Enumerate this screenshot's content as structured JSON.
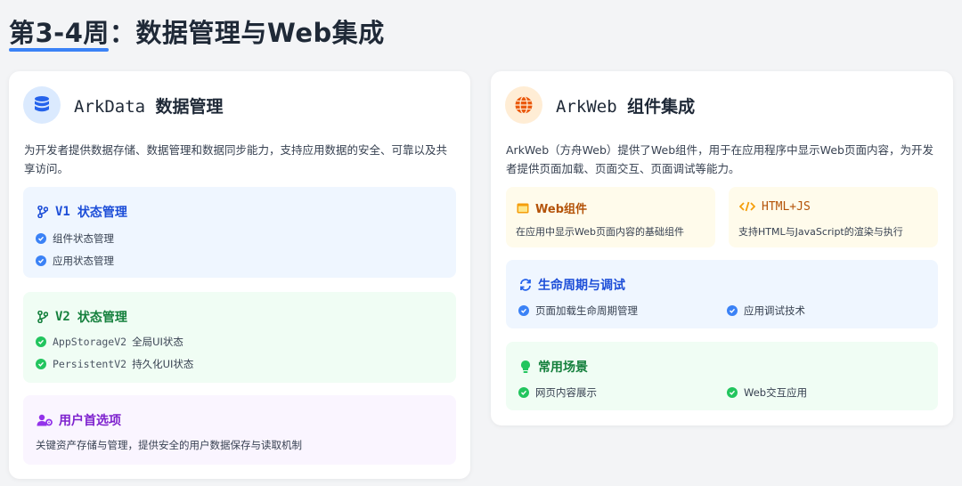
{
  "page": {
    "title": "第3-4周：数据管理与Web集成"
  },
  "colors": {
    "accent": "#3b82f6",
    "blue_text": "#1d4ed8",
    "green_text": "#15803d",
    "purple_text": "#7e22ce",
    "amber_text": "#b45309",
    "orange_icon": "#ea580c"
  },
  "left_card": {
    "icon": "database-icon",
    "title_en": "ArkData",
    "title_cn": "数据管理",
    "description": "为开发者提供数据存储、数据管理和数据同步能力，支持应用数据的安全、可靠以及共享访问。",
    "v1": {
      "title_en": "V1",
      "title_cn": "状态管理",
      "items": [
        "组件状态管理",
        "应用状态管理"
      ]
    },
    "v2": {
      "title_en": "V2",
      "title_cn": "状态管理",
      "items": [
        {
          "code": "AppStorageV2",
          "text": "全局UI状态"
        },
        {
          "code": "PersistentV2",
          "text": "持久化UI状态"
        }
      ]
    },
    "prefs": {
      "title": "用户首选项",
      "description": "关键资产存储与管理，提供安全的用户数据保存与读取机制"
    }
  },
  "right_card": {
    "icon": "globe-icon",
    "title_en": "ArkWeb",
    "title_cn": "组件集成",
    "description": "ArkWeb（方舟Web）提供了Web组件，用于在应用程序中显示Web页面内容，为开发者提供页面加载、页面交互、页面调试等能力。",
    "web_component": {
      "title": "Web组件",
      "description": "在应用中显示Web页面内容的基础组件"
    },
    "html_js": {
      "title": "HTML+JS",
      "description": "支持HTML与JavaScript的渲染与执行"
    },
    "lifecycle": {
      "title": "生命周期与调试",
      "items": [
        "页面加载生命周期管理",
        "应用调试技术"
      ]
    },
    "scenes": {
      "title": "常用场景",
      "items": [
        "网页内容展示",
        "Web交互应用"
      ]
    }
  }
}
